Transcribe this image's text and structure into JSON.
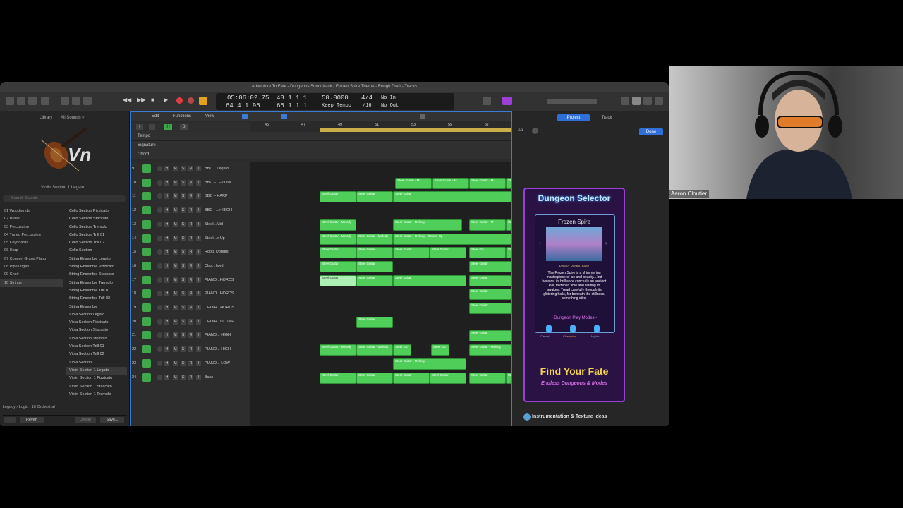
{
  "window": {
    "title": "Adventure To Fate - Dungeons Soundtrack - Frozen Spire Theme - Rough Draft - Tracks"
  },
  "lcd": {
    "time": "05:06:02.75",
    "position": "64  4  1    95",
    "bars_top": "48  1  1     1",
    "bars_bottom": "65  1  1     1",
    "tempo": "50.0000",
    "tempo_label": "Keep Tempo",
    "signature": "4/4",
    "division": "/16",
    "in_label": "No In",
    "out_label": "No Out"
  },
  "library": {
    "title": "Library",
    "scope": "All Sounds ◊",
    "instrument_badge": "Vn",
    "patch_name": "Violin Section 1 Legato",
    "search_placeholder": "Search Sounds",
    "categories": [
      "01 Woodwinds",
      "02 Brass",
      "03 Percussion",
      "04 Tuned Percussion",
      "05 Keyboards",
      "06 Harp",
      "07 Concert Grand Piano",
      "08 Pipe Organ",
      "09 Choir",
      "10 Strings"
    ],
    "patches": [
      "Cello Section Pizzicato",
      "Cello Section Staccato",
      "Cello Section Tremolo",
      "Cello Section Trill 01",
      "Cello Section Trill 02",
      "Cello Section",
      "String Ensemble Legato",
      "String Ensemble Pizzicato",
      "String Ensemble Staccato",
      "String Ensemble Tremolo",
      "String Ensemble Trill 01",
      "String Ensemble Trill 02",
      "String Ensemble",
      "Viola Section Legato",
      "Viola Section Pizzicato",
      "Viola Section Staccato",
      "Viola Section Tremolo",
      "Viola Section Trill 01",
      "Viola Section Trill 02",
      "Viola Section",
      "Violin Section 1 Legato",
      "Violin Section 1 Pizzicato",
      "Violin Section 1 Staccato",
      "Violin Section 1 Tremolo"
    ],
    "path": [
      "Legacy",
      "Logic",
      "10 Orchestral"
    ],
    "revert_label": "Revert",
    "delete_label": "Delete",
    "save_label": "Save..."
  },
  "tracks_toolbar": {
    "edit": "Edit",
    "functions": "Functions",
    "view": "View"
  },
  "global_tracks": [
    "Tempo",
    "Signature",
    "Chord"
  ],
  "ruler": [
    "45",
    "47",
    "49",
    "51",
    "53",
    "55",
    "57"
  ],
  "tracks": [
    {
      "num": "9",
      "name": "BBC ...Legato"
    },
    {
      "num": "10",
      "name": "BBC –...– LOW"
    },
    {
      "num": "11",
      "name": "BBC – HARP"
    },
    {
      "num": "12",
      "name": "BBC –...> HIGH"
    },
    {
      "num": "13",
      "name": "Steel...Mid"
    },
    {
      "num": "14",
      "name": "Steel...e Up"
    },
    {
      "num": "15",
      "name": "Roots Upright"
    },
    {
      "num": "16",
      "name": "Clas...hord"
    },
    {
      "num": "17",
      "name": "PIANO...HORDS"
    },
    {
      "num": "18",
      "name": "PIANO...HORDS"
    },
    {
      "num": "19",
      "name": "CHOIR...HORDS"
    },
    {
      "num": "20",
      "name": "CHOIR...OLUME"
    },
    {
      "num": "21",
      "name": "PIANO... HIGH"
    },
    {
      "num": "22",
      "name": "PIANO... HIGH"
    },
    {
      "num": "23",
      "name": "PIANO... LOW"
    },
    {
      "num": "24",
      "name": "Bass"
    }
  ],
  "track_buttons": [
    "M",
    "S",
    "R",
    "I"
  ],
  "region_labels": {
    "steel": "Steel Guitar",
    "steel_melody": "Steel Guitar - Melody",
    "steel_octave": "Steel Guitar - Melody - Octave Up",
    "steel_m": "Steel Guitar - M",
    "steel_short": "Steel Gu"
  },
  "inspector": {
    "tab_project": "Project",
    "tab_track": "Track",
    "done_label": "Done",
    "font_label": "Aa",
    "note_heading": "Instrumentation & Texture Ideas"
  },
  "game_card": {
    "title": "Dungeon Selector",
    "dungeon": "Frozen Spire",
    "subtitle": "Legacy Dream: Rose",
    "description": "The Frozen Spire is a shimmering masterpiece of ice and beauty... but beware, its brilliance conceals an ancient evil, frozen in time and waiting to awaken. Tread carefully through its glittering halls, for beneath the stillness, something stirs.",
    "modes_heading": "- Dungeon Play Modes -",
    "modes": [
      "Casual",
      "Champion",
      "Mythic"
    ],
    "cta": "Find Your Fate",
    "tagline": "Endless Dungeons & Modes"
  },
  "webcam": {
    "name": "Aaron Cloutier"
  },
  "colors": {
    "region_green": "#4fcf5a",
    "accent_blue": "#3a7bd5",
    "game_purple": "#9b3fd6",
    "cta_yellow": "#f2d64b"
  }
}
